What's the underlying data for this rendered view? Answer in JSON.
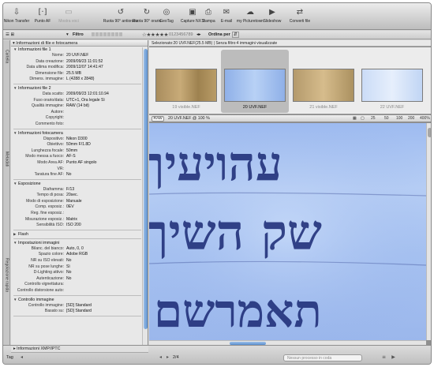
{
  "toolbar": {
    "items": [
      {
        "label": "Nikon Transfer",
        "icon": "transfer-icon"
      },
      {
        "label": "Punto AF",
        "icon": "af-point-icon"
      },
      {
        "label": "Mostra voci",
        "icon": "show-items-icon"
      },
      {
        "label": "Ruota 90° antiorario",
        "icon": "rotate-ccw-icon"
      },
      {
        "label": "Ruota 90° orario",
        "icon": "rotate-cw-icon"
      },
      {
        "label": "GeoTag",
        "icon": "geotag-icon"
      },
      {
        "label": "Capture NX 2",
        "icon": "capture-nx-icon"
      },
      {
        "label": "Stampa",
        "icon": "print-icon"
      },
      {
        "label": "E-mail",
        "icon": "email-icon"
      },
      {
        "label": "my Picturetown",
        "icon": "picturetown-icon"
      },
      {
        "label": "Slideshow",
        "icon": "slideshow-icon"
      },
      {
        "label": "Converti file",
        "icon": "convert-icon"
      }
    ]
  },
  "filterbar": {
    "filter_label": "Filtro",
    "sort_label": "Ordina per"
  },
  "sidetabs": [
    "Cartella",
    "Metadati",
    "Regolazione rapida"
  ],
  "infopanel": {
    "header": "Informazioni di file e fotocamera",
    "sections": [
      {
        "title": "Informazioni file 1",
        "rows": [
          [
            "Nome:",
            "20 UVF.NEF"
          ],
          [
            "Data creazione:",
            "2009/09/23 11:01:52"
          ],
          [
            "Data ultima modifica:",
            "2009/12/07 14:41:47"
          ],
          [
            "Dimensione file:",
            "25.5 MB"
          ],
          [
            "Dimens. immagine:",
            "L (4288 x 2848)"
          ]
        ]
      },
      {
        "title": "Informazioni file 2",
        "rows": [
          [
            "Data scatto:",
            "2009/09/23 12:01:10.94"
          ],
          [
            "Fuso orario/data:",
            "UTC+1, Ora legale Sì"
          ],
          [
            "Qualità immagine:",
            "RAW (14 bit)"
          ],
          [
            "Autore:",
            ""
          ],
          [
            "Copyright:",
            ""
          ],
          [
            "Commento foto:",
            ""
          ]
        ]
      },
      {
        "title": "Informazioni fotocamera",
        "rows": [
          [
            "Dispositivo:",
            "Nikon D300"
          ],
          [
            "Obiettivo:",
            "50mm F/1.8D"
          ],
          [
            "Lunghezza focale:",
            "50mm"
          ],
          [
            "Modo messa a fuoco:",
            "AF-S"
          ],
          [
            "Modo Area AF:",
            "Punto AF singolo"
          ],
          [
            "VR:",
            ""
          ],
          [
            "Taratura fine AF:",
            "No"
          ]
        ]
      },
      {
        "title": "Esposizione",
        "rows": [
          [
            "Diaframma:",
            "F/13"
          ],
          [
            "Tempo di posa:",
            "20sec."
          ],
          [
            "Modo di esposizione:",
            "Manuale"
          ],
          [
            "Comp. esposiz.:",
            "0EV"
          ],
          [
            "Reg. fine esposiz.:",
            ""
          ],
          [
            "Misurazione esposiz.:",
            "Matrix"
          ],
          [
            "Sensibilità ISO:",
            "ISO 200"
          ]
        ]
      },
      {
        "title": "Flash",
        "rows": []
      },
      {
        "title": "Impostazioni immagini",
        "rows": [
          [
            "Bilanc. del bianco:",
            "Auto, 0, 0"
          ],
          [
            "Spazio colore:",
            "Adobe RGB"
          ],
          [
            "NR su ISO elevati:",
            "No"
          ],
          [
            "NR su pose lunghe:",
            "Sì"
          ],
          [
            "D-Lighting attivo:",
            "No"
          ],
          [
            "Autenticazione:",
            "No"
          ],
          [
            "Controllo vignettatura:",
            ""
          ],
          [
            "Controllo distorsione auto:",
            ""
          ]
        ]
      },
      {
        "title": "Controllo immagine",
        "rows": [
          [
            "Controllo immagine:",
            "[SD] Standard"
          ],
          [
            "Basato su:",
            "[SD] Standard"
          ]
        ]
      }
    ]
  },
  "selection_text": "Selezionato:20 UVF.NEF(25.5 MB) | Senza filtro:4 immagini visualizzate",
  "thumbnails": [
    {
      "caption": "19 visible.NEF",
      "selected": false
    },
    {
      "caption": "20 UVF.NEF",
      "selected": true
    },
    {
      "caption": "21 visible.NEF",
      "selected": false
    },
    {
      "caption": "22 UVF.NEF",
      "selected": false
    }
  ],
  "imagebar": {
    "raw_label": "RAW",
    "image_name": "20 UVF.NEF @ 100 %",
    "zoom_ticks": [
      "25",
      "50",
      "100",
      "200",
      "400%"
    ]
  },
  "bottombar": {
    "xmp_label": "Informazioni XMP/IPTC",
    "tag_label": "Tag",
    "page_counter": "2/4",
    "queue_placeholder": "Nessun processo in coda"
  }
}
